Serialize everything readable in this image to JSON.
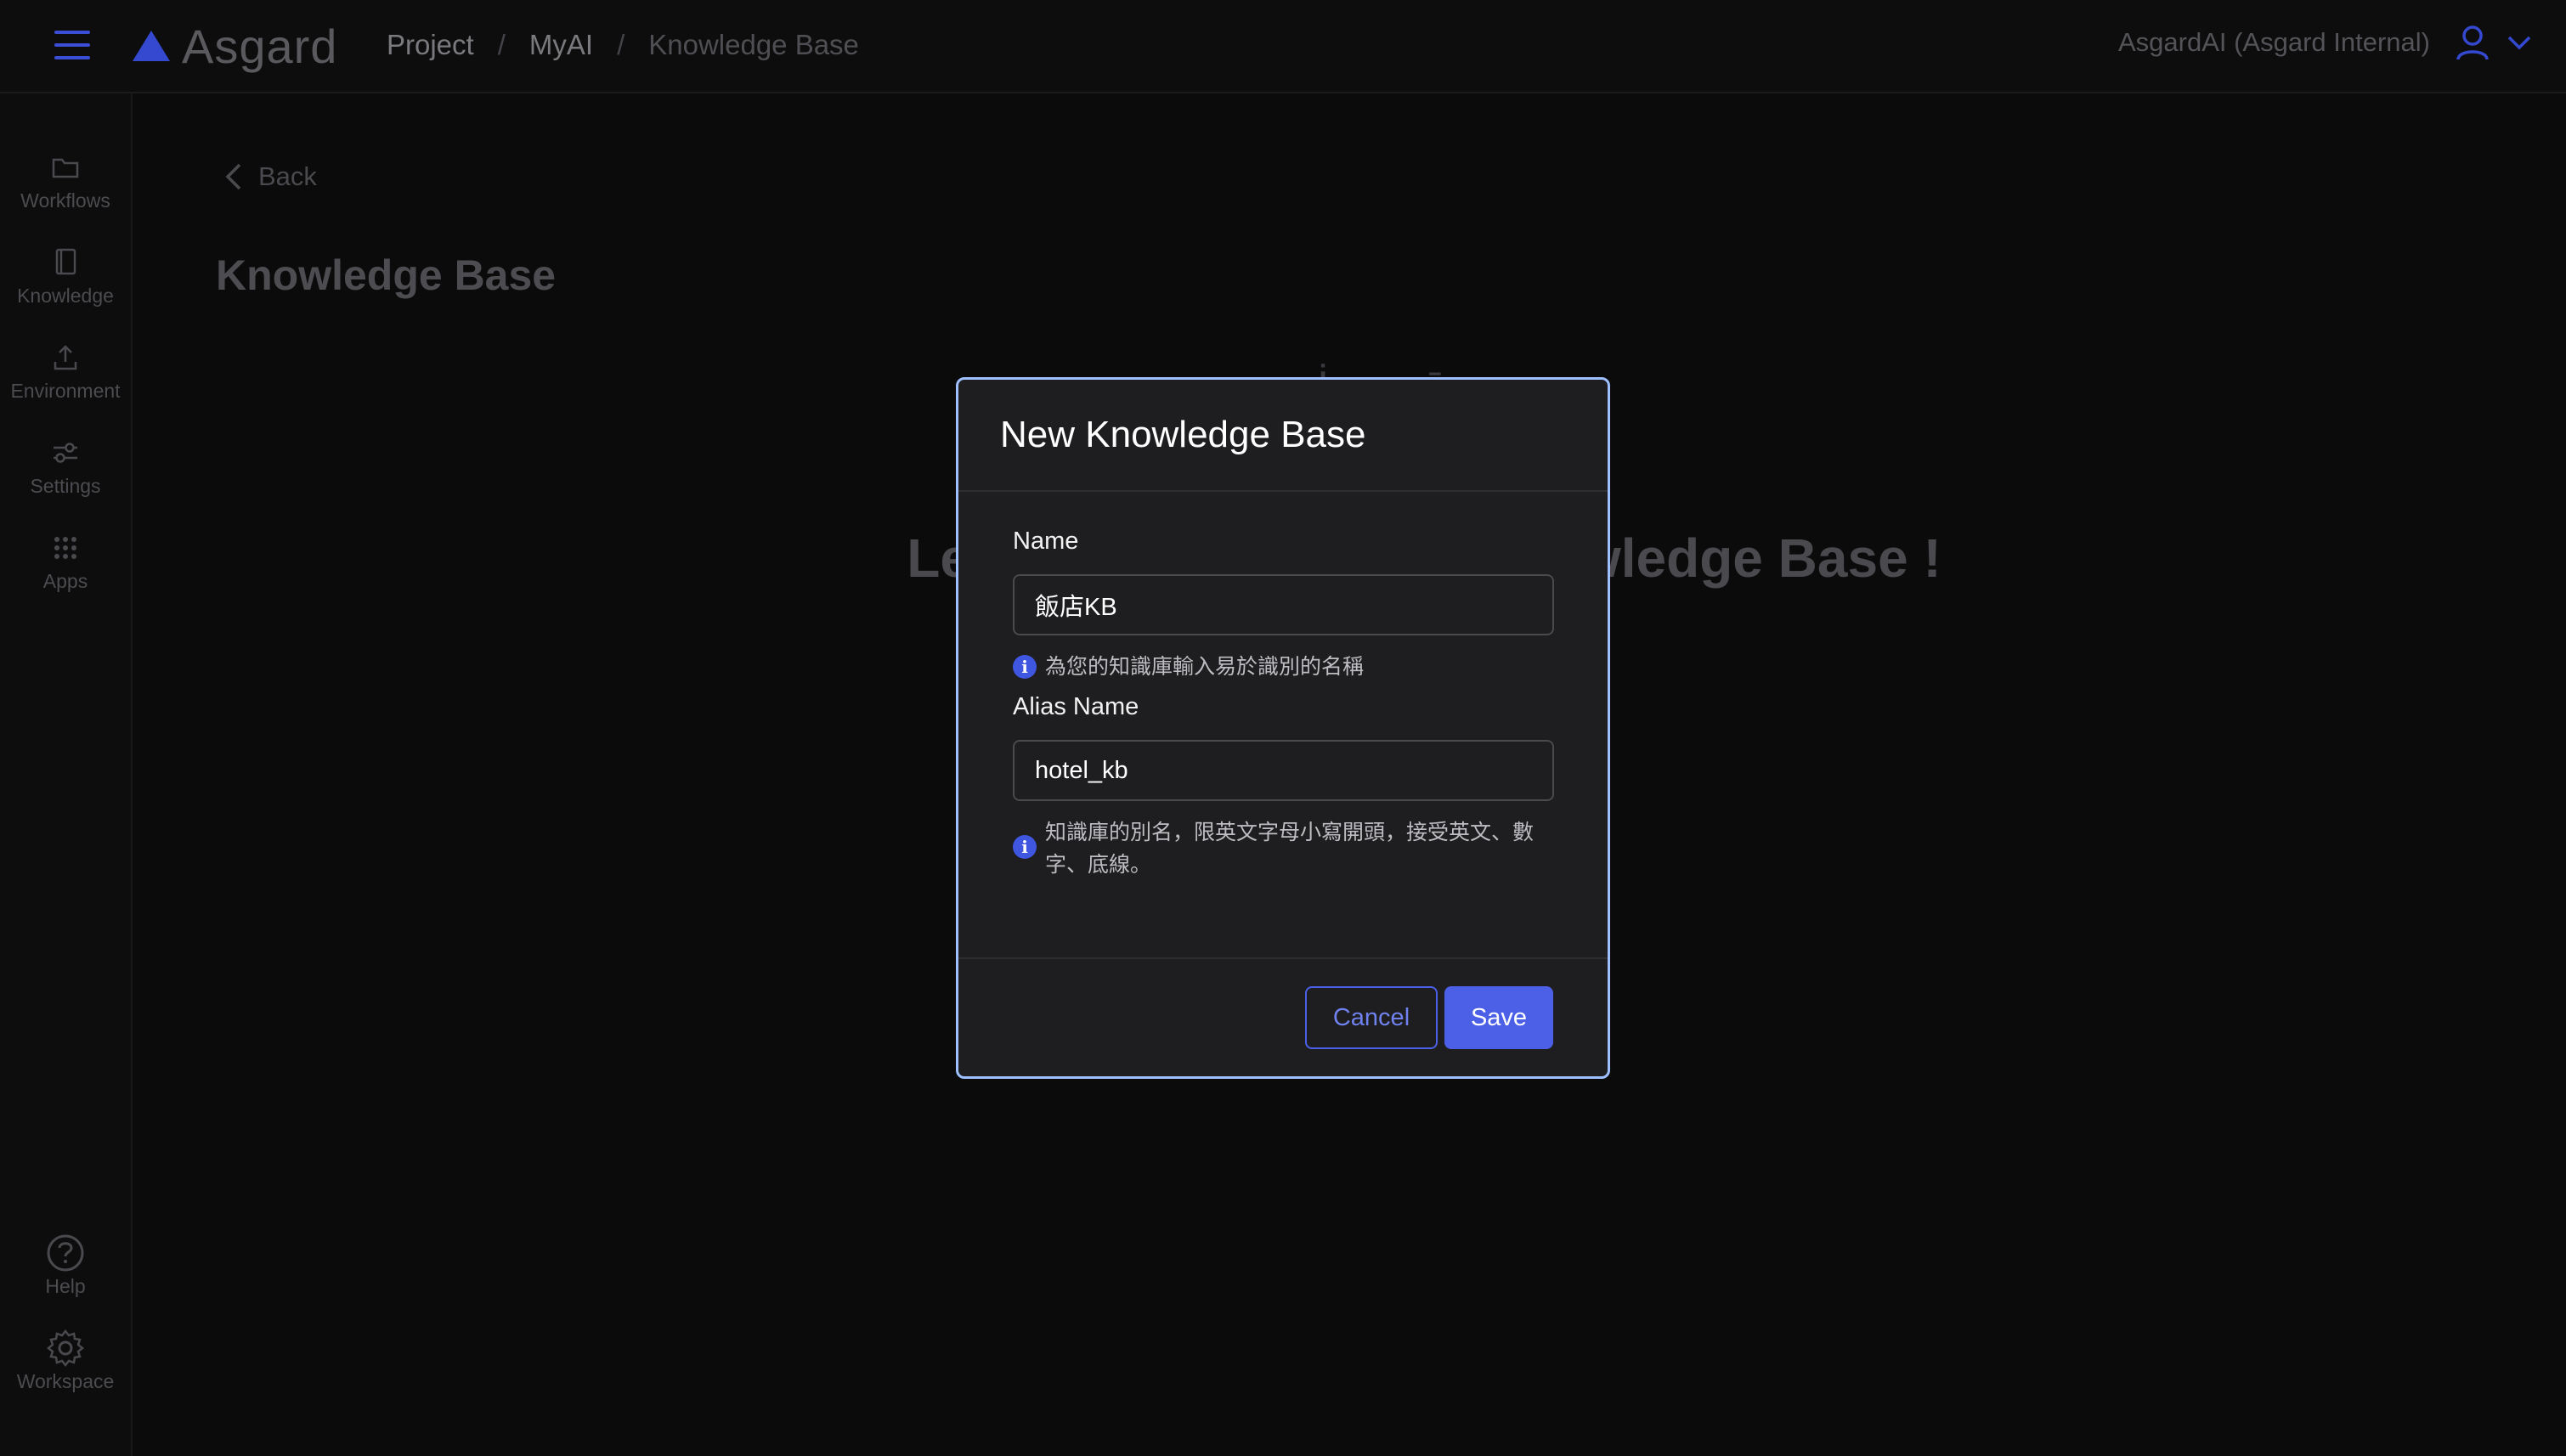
{
  "app": {
    "brand": "Asgard"
  },
  "breadcrumb": {
    "items": [
      "Project",
      "MyAI",
      "Knowledge Base"
    ],
    "separator": "/"
  },
  "account": {
    "name": "AsgardAI (Asgard Internal)"
  },
  "sidebar": {
    "items": [
      {
        "label": "Workflows",
        "icon": "folder-icon"
      },
      {
        "label": "Knowledge",
        "icon": "book-icon"
      },
      {
        "label": "Environment",
        "icon": "upload-icon"
      },
      {
        "label": "Settings",
        "icon": "sliders-icon"
      },
      {
        "label": "Apps",
        "icon": "grid-icon"
      }
    ],
    "bottom": [
      {
        "label": "Help",
        "icon": "help-icon"
      },
      {
        "label": "Workspace",
        "icon": "gear-icon"
      }
    ]
  },
  "main": {
    "back_label": "Back",
    "title": "Knowledge Base",
    "empty_emoji": "ıİı ī",
    "empty_headline": "Let’s create your first Knowledge Base !"
  },
  "modal": {
    "title": "New Knowledge Base",
    "name_label": "Name",
    "name_value": "飯店KB",
    "name_hint": "為您的知識庫輸入易於識別的名稱",
    "alias_label": "Alias Name",
    "alias_value": "hotel_kb",
    "alias_hint": "知識庫的別名，限英文字母小寫開頭，接受英文、數字、底線。",
    "cancel_label": "Cancel",
    "save_label": "Save"
  },
  "colors": {
    "accent": "#4b60e6",
    "modal_border": "#9fc0ff",
    "background": "#0b0b0c"
  }
}
